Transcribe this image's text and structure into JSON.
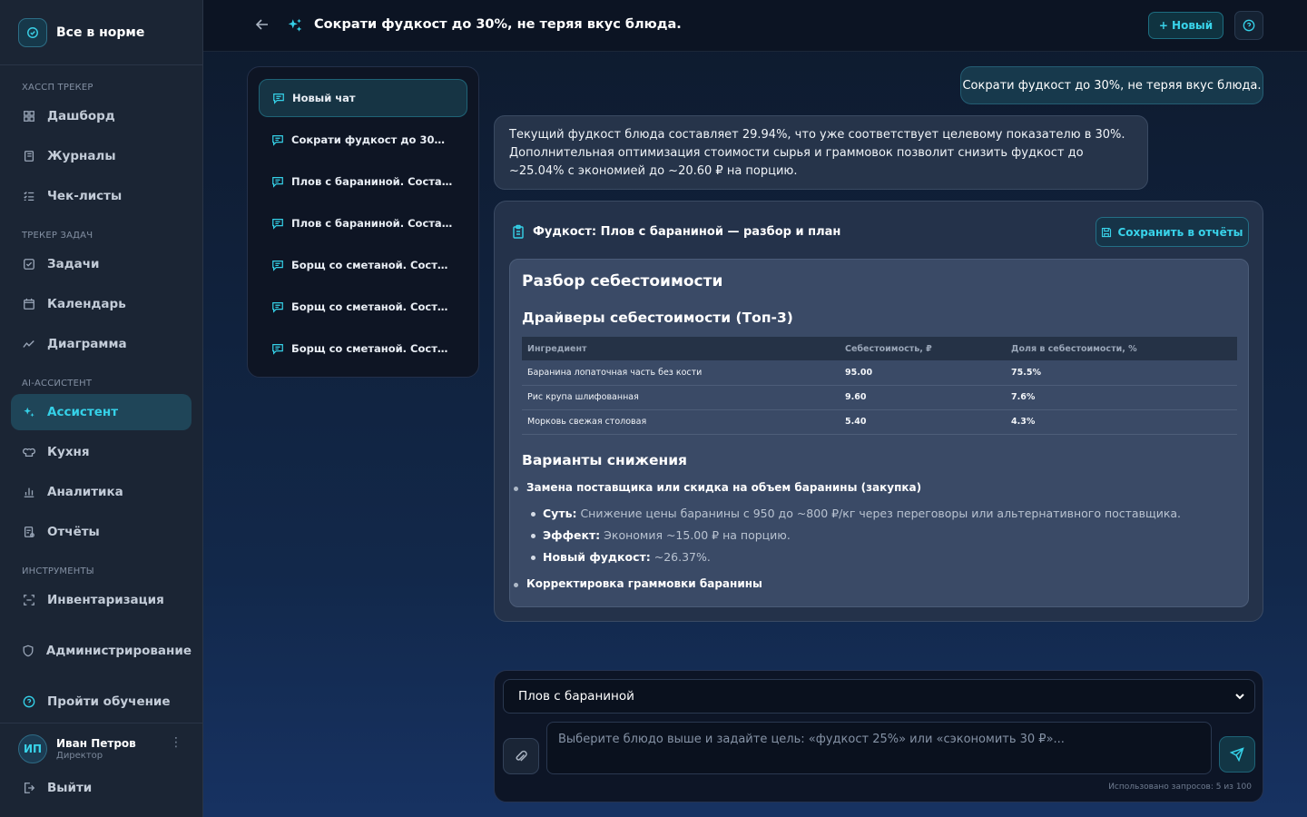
{
  "sidebar": {
    "brand": "Все в норме",
    "sections": {
      "haccp": "ХАССП трекер",
      "tasks": "Трекер задач",
      "ai": "AI-ассистент",
      "tools": "Инструменты"
    },
    "items": {
      "dashboard": "Дашборд",
      "journals": "Журналы",
      "checklists": "Чек-листы",
      "tasks": "Задачи",
      "calendar": "Календарь",
      "chart": "Диаграмма",
      "assistant": "Ассистент",
      "kitchen": "Кухня",
      "analytics": "Аналитика",
      "reports": "Отчёты",
      "inventory": "Инвентаризация",
      "admin": "Администрирование",
      "training": "Пройти обучение"
    },
    "user": {
      "initials": "ИП",
      "name": "Иван Петров",
      "role": "Директор"
    },
    "logout": "Выйти"
  },
  "header": {
    "title": "Сократи фудкост до 30%, не теряя вкус блюда.",
    "new_button": "+ Новый"
  },
  "history": [
    "Новый чат",
    "Сократи фудкост до 30%, ...",
    "Плов с бараниной. Состав:...",
    "Плов с бараниной. Состав:...",
    "Борщ со сметаной. Состав...",
    "Борщ со сметаной. Состав...",
    "Борщ со сметаной. Состав..."
  ],
  "messages": {
    "user": "Сократи фудкост до 30%, не теряя вкус блюда.",
    "assistant": "Текущий фудкост блюда составляет 29.94%, что уже соответствует целевому показателю в 30%. Дополнительная оптимизация стоимости сырья и граммовок позволит снизить фудкост до ~25.04% с экономией до ~20.60 ₽ на порцию."
  },
  "report": {
    "title": "Фудкост: Плов с бараниной — разбор и план",
    "save_button": "Сохранить в отчёты",
    "h1": "Разбор себестоимости",
    "h2_drivers": "Драйверы себестоимости (Топ-3)",
    "table": {
      "headers": [
        "Ингредиент",
        "Себестоимость, ₽",
        "Доля в себестоимости, %"
      ],
      "rows": [
        [
          "Баранина лопаточная часть без кости",
          "95.00",
          "75.5%"
        ],
        [
          "Рис крупа шлифованная",
          "9.60",
          "7.6%"
        ],
        [
          "Морковь свежая столовая",
          "5.40",
          "4.3%"
        ]
      ]
    },
    "h2_options": "Варианты снижения",
    "option1": {
      "title": "Замена поставщика или скидка на объем баранины (закупка)",
      "essence_label": "Суть:",
      "essence": " Снижение цены баранины с 950 до ~800 ₽/кг через переговоры или альтернативного поставщика.",
      "effect_label": "Эффект:",
      "effect": " Экономия ~15.00 ₽ на порцию.",
      "newcost_label": "Новый фудкост:",
      "newcost": " ~26.37%."
    },
    "option2": {
      "title": "Корректировка граммовки баранины"
    }
  },
  "composer": {
    "selected_dish": "Плов с бараниной",
    "placeholder": "Выберите блюдо выше и задайте цель: «фудкост 25%» или «сэкономить 30 ₽»...",
    "usage": "Использовано запросов: 5 из 100"
  },
  "colors": {
    "accent": "#35d1e8",
    "sidebar": "#1b2534",
    "topbar": "#0c1423"
  }
}
